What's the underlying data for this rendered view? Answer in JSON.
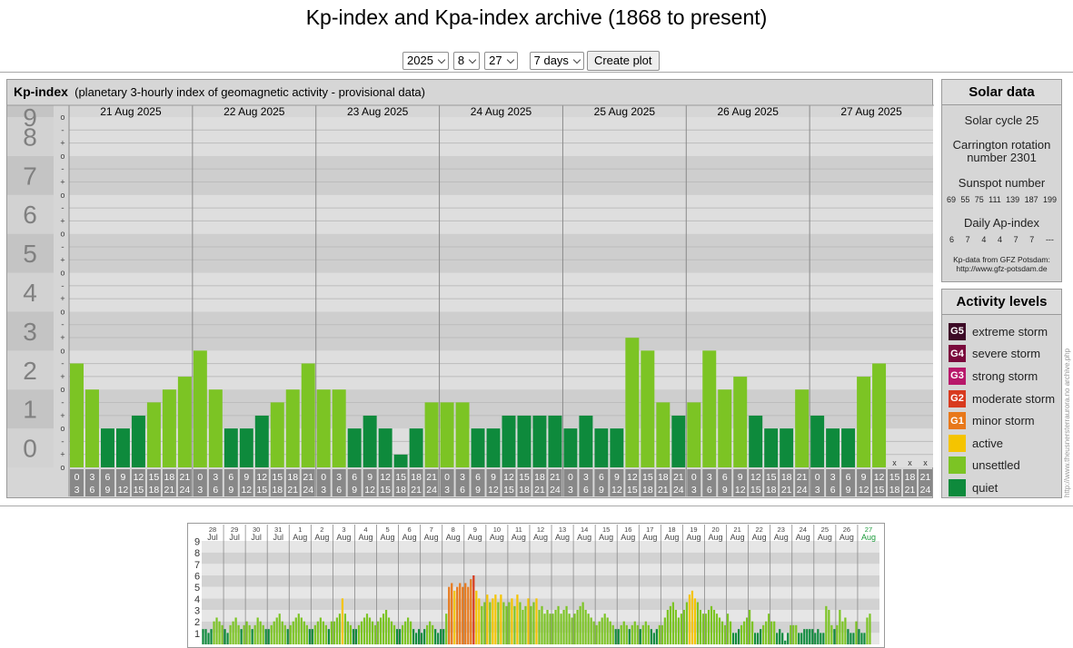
{
  "title": "Kp-index and Kpa-index archive (1868 to present)",
  "controls": {
    "year": "2025",
    "month": "8",
    "day": "27",
    "span": "7 days",
    "create_button": "Create plot"
  },
  "kp_panel": {
    "name": "Kp-index",
    "subtitle": "(planetary 3-hourly index of geomagnetic activity - provisional data)"
  },
  "solar": {
    "title": "Solar data",
    "cycle": "Solar cycle 25",
    "carrington": "Carrington rotation number 2301",
    "sunspot_label": "Sunspot number",
    "sunspots": [
      "69",
      "55",
      "75",
      "111",
      "139",
      "187",
      "199"
    ],
    "ap_label": "Daily Ap-index",
    "ap": [
      "6",
      "7",
      "4",
      "4",
      "7",
      "7",
      "---"
    ],
    "source_line1": "Kp-data from GFZ Potsdam:",
    "source_line2": "http://www.gfz-potsdam.de"
  },
  "levels": {
    "title": "Activity levels",
    "items": [
      {
        "badge": "G5",
        "label": "extreme storm",
        "color": "#3c0a26"
      },
      {
        "badge": "G4",
        "label": "severe storm",
        "color": "#7a0a3c"
      },
      {
        "badge": "G3",
        "label": "strong storm",
        "color": "#b8186a"
      },
      {
        "badge": "G2",
        "label": "moderate storm",
        "color": "#d83a1e"
      },
      {
        "badge": "G1",
        "label": "minor storm",
        "color": "#e8781a"
      },
      {
        "badge": "",
        "label": "active",
        "color": "#f5c400"
      },
      {
        "badge": "",
        "label": "unsettled",
        "color": "#7cc424"
      },
      {
        "badge": "",
        "label": "quiet",
        "color": "#0e8a3c"
      }
    ]
  },
  "credit": "http://www.theusnersterraurora.no  archive.php",
  "colors": {
    "quiet": "#0e8a3c",
    "unsettled": "#7cc424",
    "active": "#f5c400",
    "minor": "#e8781a",
    "moderate": "#d83a1e"
  },
  "chart_data": [
    {
      "type": "bar",
      "ylim": [
        0,
        9
      ],
      "y_tick_labels": [
        "0",
        "1",
        "2",
        "3",
        "4",
        "5",
        "6",
        "7",
        "8",
        "9"
      ],
      "minor_tick_labels": [
        "-",
        "o",
        "+"
      ],
      "days": [
        "21 Aug 2025",
        "22 Aug 2025",
        "23 Aug 2025",
        "24 Aug 2025",
        "25 Aug 2025",
        "26 Aug 2025",
        "27 Aug 2025"
      ],
      "hour_labels": [
        [
          "0",
          "3"
        ],
        [
          "3",
          "6"
        ],
        [
          "6",
          "9"
        ],
        [
          "9",
          "12"
        ],
        [
          "12",
          "15"
        ],
        [
          "15",
          "18"
        ],
        [
          "18",
          "21"
        ],
        [
          "21",
          "24"
        ]
      ],
      "missing_mark": "x",
      "values": [
        [
          2.67,
          2.0,
          1.0,
          1.0,
          1.33,
          1.67,
          2.0,
          2.33
        ],
        [
          3.0,
          2.0,
          1.0,
          1.0,
          1.33,
          1.67,
          2.0,
          2.67
        ],
        [
          2.0,
          2.0,
          1.0,
          1.33,
          1.0,
          0.33,
          1.0,
          1.67
        ],
        [
          1.67,
          1.67,
          1.0,
          1.0,
          1.33,
          1.33,
          1.33,
          1.33
        ],
        [
          1.0,
          1.33,
          1.0,
          1.0,
          3.33,
          3.0,
          1.67,
          1.33
        ],
        [
          1.67,
          3.0,
          2.0,
          2.33,
          1.33,
          1.0,
          1.0,
          2.0
        ],
        [
          1.33,
          1.0,
          1.0,
          2.33,
          2.67,
          null,
          null,
          null
        ]
      ]
    },
    {
      "type": "bar",
      "ylim": [
        0,
        9
      ],
      "y_tick_labels": [
        "1",
        "2",
        "3",
        "4",
        "5",
        "6",
        "7",
        "8",
        "9"
      ],
      "x_labels": [
        {
          "day": "28",
          "month": "Jul"
        },
        {
          "day": "29",
          "month": "Jul"
        },
        {
          "day": "30",
          "month": "Jul"
        },
        {
          "day": "31",
          "month": "Jul"
        },
        {
          "day": "1",
          "month": "Aug"
        },
        {
          "day": "2",
          "month": "Aug"
        },
        {
          "day": "3",
          "month": "Aug"
        },
        {
          "day": "4",
          "month": "Aug"
        },
        {
          "day": "5",
          "month": "Aug"
        },
        {
          "day": "6",
          "month": "Aug"
        },
        {
          "day": "7",
          "month": "Aug"
        },
        {
          "day": "8",
          "month": "Aug"
        },
        {
          "day": "9",
          "month": "Aug"
        },
        {
          "day": "10",
          "month": "Aug"
        },
        {
          "day": "11",
          "month": "Aug"
        },
        {
          "day": "12",
          "month": "Aug"
        },
        {
          "day": "13",
          "month": "Aug"
        },
        {
          "day": "14",
          "month": "Aug"
        },
        {
          "day": "15",
          "month": "Aug"
        },
        {
          "day": "16",
          "month": "Aug"
        },
        {
          "day": "17",
          "month": "Aug"
        },
        {
          "day": "18",
          "month": "Aug"
        },
        {
          "day": "19",
          "month": "Aug"
        },
        {
          "day": "20",
          "month": "Aug"
        },
        {
          "day": "21",
          "month": "Aug"
        },
        {
          "day": "22",
          "month": "Aug"
        },
        {
          "day": "23",
          "month": "Aug"
        },
        {
          "day": "24",
          "month": "Aug"
        },
        {
          "day": "25",
          "month": "Aug"
        },
        {
          "day": "26",
          "month": "Aug"
        },
        {
          "day": "27",
          "month": "Aug"
        }
      ],
      "values": [
        [
          1.33,
          1.33,
          1.0,
          1.33,
          2.0,
          2.33,
          2.0,
          1.67
        ],
        [
          1.33,
          1.0,
          1.67,
          2.0,
          2.33,
          1.67,
          1.33,
          1.67
        ],
        [
          2.0,
          1.67,
          1.33,
          1.67,
          2.33,
          2.0,
          1.67,
          1.33
        ],
        [
          1.33,
          1.67,
          2.0,
          2.33,
          2.67,
          2.0,
          1.67,
          1.33
        ],
        [
          1.67,
          2.0,
          2.33,
          2.67,
          2.33,
          2.0,
          1.67,
          1.33
        ],
        [
          1.33,
          1.67,
          2.0,
          2.33,
          2.0,
          1.67,
          1.33,
          2.0
        ],
        [
          2.0,
          2.33,
          2.67,
          4.0,
          2.67,
          2.0,
          1.67,
          1.33
        ],
        [
          1.33,
          1.67,
          2.0,
          2.33,
          2.67,
          2.33,
          2.0,
          1.67
        ],
        [
          2.0,
          2.33,
          2.67,
          3.0,
          2.33,
          2.0,
          1.67,
          1.33
        ],
        [
          1.33,
          1.67,
          2.0,
          2.33,
          2.0,
          1.33,
          1.0,
          1.33
        ],
        [
          1.0,
          1.33,
          1.67,
          2.0,
          1.67,
          1.33,
          1.0,
          1.33
        ],
        [
          1.33,
          2.67,
          5.0,
          5.33,
          4.67,
          5.0,
          5.33,
          5.0
        ],
        [
          5.33,
          5.0,
          5.67,
          6.0,
          4.67,
          4.0,
          3.33,
          3.67
        ],
        [
          4.33,
          3.67,
          4.0,
          4.33,
          3.67,
          4.33,
          3.67,
          3.33
        ],
        [
          3.67,
          4.0,
          3.33,
          4.33,
          3.67,
          3.0,
          3.33,
          4.0
        ],
        [
          3.33,
          3.67,
          4.0,
          3.0,
          3.33,
          2.67,
          3.0,
          2.67
        ],
        [
          2.67,
          3.0,
          3.33,
          2.67,
          3.0,
          3.33,
          2.67,
          2.33
        ],
        [
          2.67,
          3.0,
          3.33,
          3.67,
          3.0,
          2.67,
          2.33,
          2.0
        ],
        [
          1.67,
          2.0,
          2.33,
          2.67,
          2.33,
          2.0,
          1.67,
          1.33
        ],
        [
          1.33,
          1.67,
          2.0,
          1.67,
          1.33,
          1.67,
          2.0,
          1.67
        ],
        [
          1.33,
          1.67,
          2.0,
          1.67,
          1.33,
          1.0,
          1.33,
          1.67
        ],
        [
          1.67,
          2.33,
          3.0,
          3.33,
          3.67,
          3.0,
          2.33,
          2.67
        ],
        [
          3.0,
          3.67,
          4.33,
          4.67,
          4.0,
          3.67,
          3.0,
          2.67
        ],
        [
          2.67,
          3.0,
          3.33,
          3.0,
          2.67,
          2.33,
          2.0,
          1.67
        ],
        [
          2.67,
          2.0,
          1.0,
          1.0,
          1.33,
          1.67,
          2.0,
          2.33
        ],
        [
          3.0,
          2.0,
          1.0,
          1.0,
          1.33,
          1.67,
          2.0,
          2.67
        ],
        [
          2.0,
          2.0,
          1.0,
          1.33,
          1.0,
          0.33,
          1.0,
          1.67
        ],
        [
          1.67,
          1.67,
          1.0,
          1.0,
          1.33,
          1.33,
          1.33,
          1.33
        ],
        [
          1.0,
          1.33,
          1.0,
          1.0,
          3.33,
          3.0,
          1.67,
          1.33
        ],
        [
          1.67,
          3.0,
          2.0,
          2.33,
          1.33,
          1.0,
          1.0,
          2.0
        ],
        [
          1.33,
          1.0,
          1.0,
          2.33,
          2.67,
          null,
          null,
          null
        ]
      ]
    }
  ]
}
